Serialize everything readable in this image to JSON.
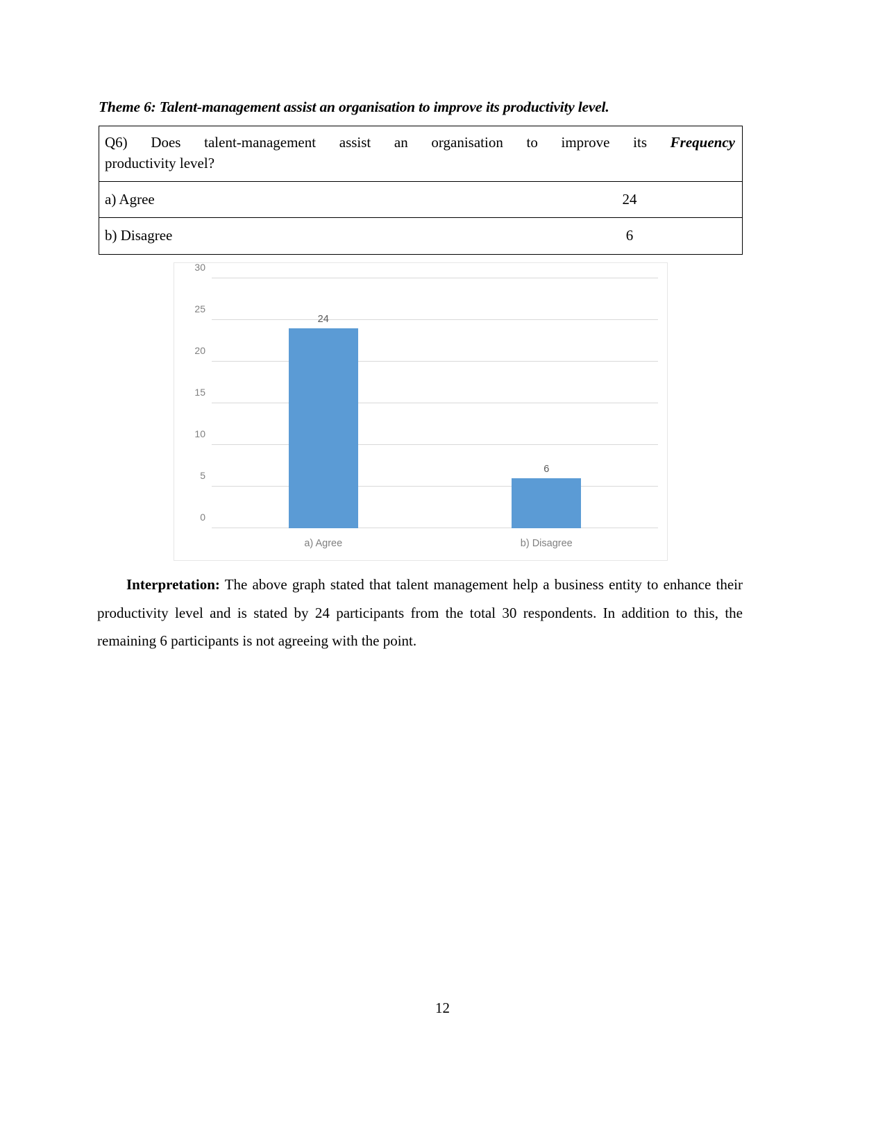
{
  "document": {
    "theme_heading": "Theme 6: Talent-management assist an organisation to improve its productivity level.",
    "page_number": "12"
  },
  "question_table": {
    "question_line1": "Q6)   Does   talent-management   assist   an   organisation   to   improve   its ",
    "question_frequency_header": "Frequency",
    "question_line2": "productivity level?",
    "rows": [
      {
        "label": "a) Agree",
        "value": "24"
      },
      {
        "label": "b) Disagree",
        "value": "6"
      }
    ]
  },
  "chart_data": {
    "type": "bar",
    "categories": [
      "a) Agree",
      "b) Disagree"
    ],
    "values": [
      24,
      6
    ],
    "data_labels": [
      "24",
      "6"
    ],
    "title": "",
    "xlabel": "",
    "ylabel": "",
    "ylim": [
      0,
      30
    ],
    "yticks": [
      0,
      5,
      10,
      15,
      20,
      25,
      30
    ],
    "ytick_labels": [
      "0",
      "5",
      "10",
      "15",
      "20",
      "25",
      "30"
    ],
    "grid": true,
    "legend": "none",
    "series_color": "#5B9BD5",
    "gridline_color": "#D9D9D9",
    "tick_label_color": "#7F7F7F",
    "data_label_color": "#595959"
  },
  "interpretation": {
    "lead": "Interpretation:",
    "body": " The above graph stated that talent management help a business entity to enhance their productivity level and is stated by 24 participants from the total 30 respondents. In addition to this, the remaining 6 participants is not agreeing with the point."
  }
}
